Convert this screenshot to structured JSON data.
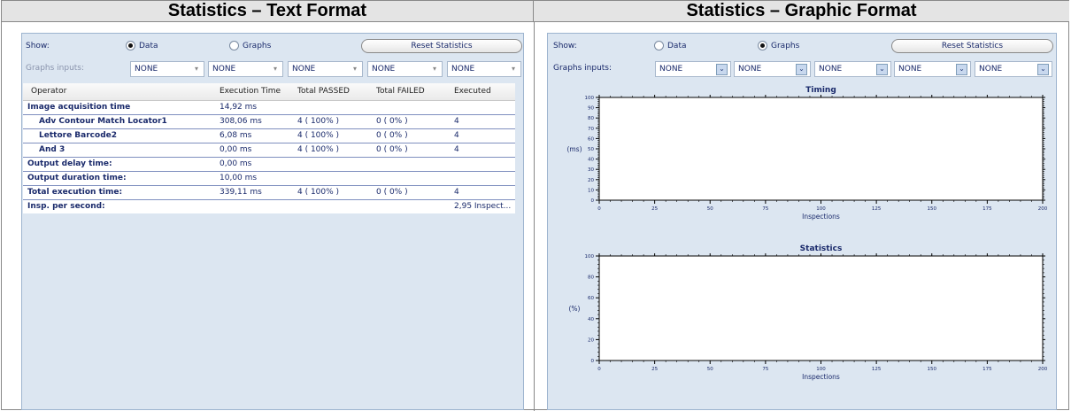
{
  "headers": {
    "left": "Statistics – Text Format",
    "right": "Statistics – Graphic Format"
  },
  "text_panel": {
    "show_label": "Show:",
    "radio_data": "Data",
    "radio_graphs": "Graphs",
    "selected": "Data",
    "reset_label": "Reset Statistics",
    "graphs_inputs_label": "Graphs inputs:",
    "inputs": [
      "NONE",
      "NONE",
      "NONE",
      "NONE",
      "NONE"
    ],
    "columns": [
      "Operator",
      "Execution Time",
      "Total PASSED",
      "Total FAILED",
      "Executed"
    ],
    "rows": [
      {
        "op": "Image acquisition time",
        "time": "14,92 ms",
        "passed": "",
        "failed": "",
        "executed": "",
        "indent": false
      },
      {
        "op": "Adv Contour Match Locator1",
        "time": "308,06 ms",
        "passed": "4 ( 100% )",
        "failed": "0 ( 0% )",
        "executed": "4",
        "indent": true
      },
      {
        "op": "Lettore Barcode2",
        "time": "6,08 ms",
        "passed": "4 ( 100% )",
        "failed": "0 ( 0% )",
        "executed": "4",
        "indent": true
      },
      {
        "op": "And 3",
        "time": "0,00 ms",
        "passed": "4 ( 100% )",
        "failed": "0 ( 0% )",
        "executed": "4",
        "indent": true
      },
      {
        "op": "Output delay time:",
        "time": "0,00 ms",
        "passed": "",
        "failed": "",
        "executed": "",
        "indent": false
      },
      {
        "op": "Output duration time:",
        "time": "10,00 ms",
        "passed": "",
        "failed": "",
        "executed": "",
        "indent": false
      },
      {
        "op": "Total execution time:",
        "time": "339,11 ms",
        "passed": "4 ( 100% )",
        "failed": "0 ( 0% )",
        "executed": "4",
        "indent": false
      },
      {
        "op": "Insp. per second:",
        "time": "",
        "passed": "",
        "failed": "",
        "executed": "2,95 Inspect...",
        "indent": false
      }
    ]
  },
  "graphic_panel": {
    "show_label": "Show:",
    "radio_data": "Data",
    "radio_graphs": "Graphs",
    "selected": "Graphs",
    "reset_label": "Reset Statistics",
    "graphs_inputs_label": "Graphs inputs:",
    "inputs": [
      "NONE",
      "NONE",
      "NONE",
      "NONE",
      "NONE"
    ]
  },
  "chart_data": [
    {
      "type": "line",
      "title": "Timing",
      "xlabel": "Inspections",
      "ylabel": "(ms)",
      "xlim": [
        0,
        200
      ],
      "ylim": [
        0,
        100
      ],
      "x_ticks": [
        0,
        25,
        50,
        75,
        100,
        125,
        150,
        175,
        200
      ],
      "y_ticks": [
        0,
        10,
        20,
        30,
        40,
        50,
        60,
        70,
        80,
        90,
        100
      ],
      "series": []
    },
    {
      "type": "line",
      "title": "Statistics",
      "xlabel": "Inspections",
      "ylabel": "(%)",
      "xlim": [
        0,
        200
      ],
      "ylim": [
        0,
        100
      ],
      "x_ticks": [
        0,
        25,
        50,
        75,
        100,
        125,
        150,
        175,
        200
      ],
      "y_ticks": [
        0,
        20,
        40,
        60,
        80,
        100
      ],
      "series": []
    }
  ],
  "colors": {
    "panel_bg": "#dce6f1",
    "text": "#1a2a6b",
    "row_line": "#7f8fbf"
  }
}
